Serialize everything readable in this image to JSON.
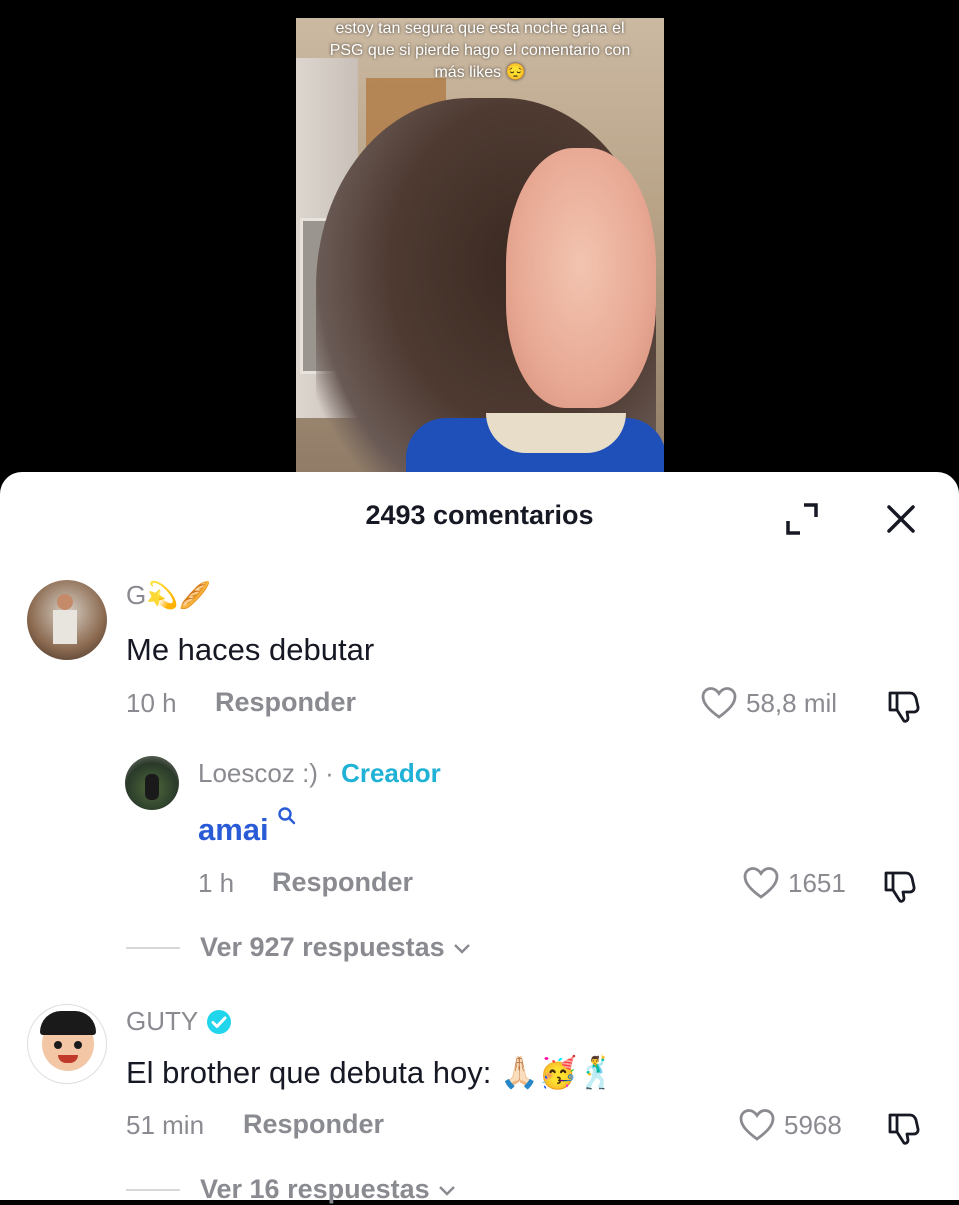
{
  "video": {
    "caption": "estoy tan segura que esta noche gana el PSG que si pierde hago el comentario con más likes 😔"
  },
  "sheet": {
    "title": "2493 comentarios"
  },
  "comments": [
    {
      "username": "G💫🥖",
      "text": "Me haces debutar",
      "time": "10 h",
      "reply_label": "Responder",
      "likes": "58,8 mil"
    },
    {
      "username": "Loescoz :)",
      "separator": " · ",
      "creator_badge": "Creador",
      "text": "amai",
      "time": "1 h",
      "reply_label": "Responder",
      "likes": "1651",
      "link_color": "#2a5bd7",
      "creator_color": "#20b2d6"
    },
    {
      "username": "GUTY",
      "verified": true,
      "text": "El brother que debuta hoy: 🙏🏻🥳🕺",
      "time": "51 min",
      "reply_label": "Responder",
      "likes": "5968"
    }
  ],
  "view_replies": [
    "Ver 927 respuestas",
    "Ver 16 respuestas"
  ],
  "colors": {
    "text": "#161823",
    "muted": "#8a8b91",
    "verified": "#20d5ec"
  }
}
